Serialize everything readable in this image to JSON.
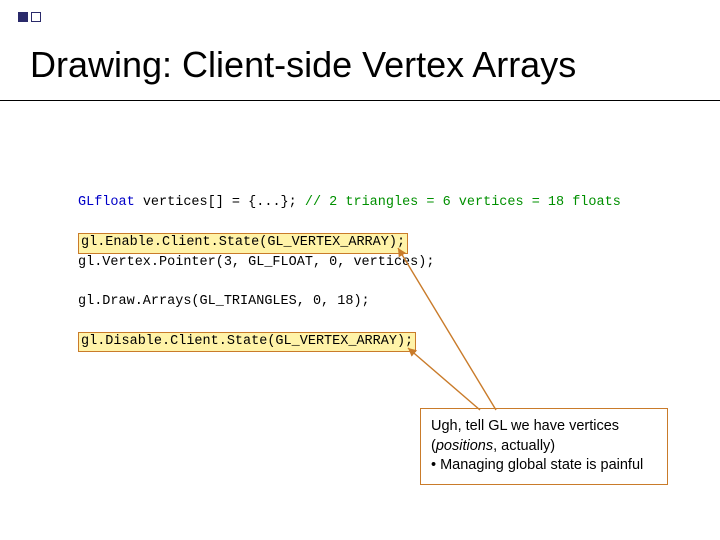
{
  "title": "Drawing:  Client-side Vertex Arrays",
  "code": {
    "line1": {
      "type": "GLfloat",
      "rest": " vertices[] = {...}; ",
      "comment": "// 2 triangles = 6 vertices = 18 floats"
    },
    "highlight1": "gl.Enable.Client.State(GL_VERTEX_ARRAY);",
    "line2": "gl.Vertex.Pointer(3, GL_FLOAT, 0, vertices);",
    "line3": "gl.Draw.Arrays(GL_TRIANGLES, 0, 18);",
    "highlight2": "gl.Disable.Client.State(GL_VERTEX_ARRAY);"
  },
  "callout": {
    "line1a": "Ugh, tell GL we have vertices",
    "line2_open": "(",
    "line2_italic": "positions",
    "line2_close": ", actually)",
    "line3": "• Managing global state is painful"
  }
}
